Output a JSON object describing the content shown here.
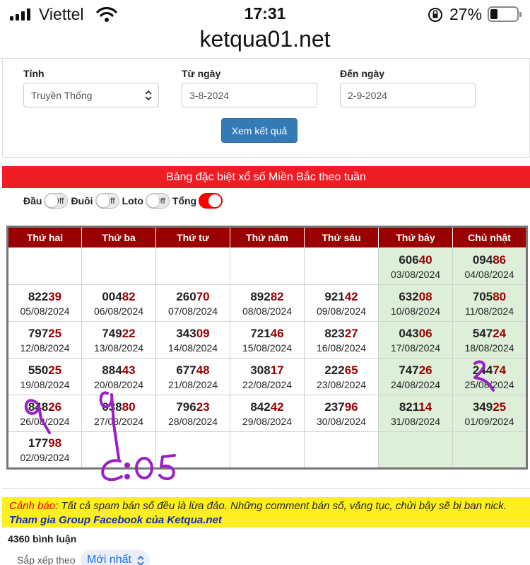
{
  "status_bar": {
    "carrier": "Viettel",
    "time": "17:31",
    "battery_percent": "27%",
    "battery_level": 0.27
  },
  "browser": {
    "url": "ketqua01.net"
  },
  "filter": {
    "province_label": "Tỉnh",
    "province_value": "Truyền Thống",
    "from_label": "Từ ngày",
    "from_value": "3-8-2024",
    "to_label": "Đến ngày",
    "to_value": "2-9-2024",
    "submit_label": "Xem kết quả"
  },
  "banner_title": "Bảng đặc biệt xổ số Miền Bắc theo tuần",
  "toggles": [
    {
      "label": "Đầu",
      "state": "Off"
    },
    {
      "label": "Đuôi",
      "state": "Off"
    },
    {
      "label": "Loto",
      "state": "Off"
    },
    {
      "label": "Tổng",
      "state": ""
    }
  ],
  "table": {
    "headers": [
      "Thứ hai",
      "Thứ ba",
      "Thứ tư",
      "Thứ năm",
      "Thứ sáu",
      "Thứ bảy",
      "Chủ nhật"
    ],
    "rows": [
      [
        {
          "num": "",
          "tail": "",
          "date": ""
        },
        {
          "num": "",
          "tail": "",
          "date": ""
        },
        {
          "num": "",
          "tail": "",
          "date": ""
        },
        {
          "num": "",
          "tail": "",
          "date": ""
        },
        {
          "num": "",
          "tail": "",
          "date": ""
        },
        {
          "num": "606",
          "tail": "40",
          "date": "03/08/2024"
        },
        {
          "num": "094",
          "tail": "86",
          "date": "04/08/2024"
        }
      ],
      [
        {
          "num": "822",
          "tail": "39",
          "date": "05/08/2024"
        },
        {
          "num": "004",
          "tail": "82",
          "date": "06/08/2024"
        },
        {
          "num": "260",
          "tail": "70",
          "date": "07/08/2024"
        },
        {
          "num": "892",
          "tail": "82",
          "date": "08/08/2024"
        },
        {
          "num": "921",
          "tail": "42",
          "date": "09/08/2024"
        },
        {
          "num": "632",
          "tail": "08",
          "date": "10/08/2024"
        },
        {
          "num": "705",
          "tail": "80",
          "date": "11/08/2024"
        }
      ],
      [
        {
          "num": "797",
          "tail": "25",
          "date": "12/08/2024"
        },
        {
          "num": "749",
          "tail": "22",
          "date": "13/08/2024"
        },
        {
          "num": "343",
          "tail": "09",
          "date": "14/08/2024"
        },
        {
          "num": "721",
          "tail": "46",
          "date": "15/08/2024"
        },
        {
          "num": "823",
          "tail": "27",
          "date": "16/08/2024"
        },
        {
          "num": "043",
          "tail": "06",
          "date": "17/08/2024"
        },
        {
          "num": "547",
          "tail": "24",
          "date": "18/08/2024"
        }
      ],
      [
        {
          "num": "550",
          "tail": "25",
          "date": "19/08/2024"
        },
        {
          "num": "884",
          "tail": "43",
          "date": "20/08/2024"
        },
        {
          "num": "677",
          "tail": "48",
          "date": "21/08/2024"
        },
        {
          "num": "308",
          "tail": "17",
          "date": "22/08/2024"
        },
        {
          "num": "222",
          "tail": "65",
          "date": "23/08/2024"
        },
        {
          "num": "747",
          "tail": "26",
          "date": "24/08/2024"
        },
        {
          "num": "244",
          "tail": "74",
          "date": "25/08/2024"
        }
      ],
      [
        {
          "num": "848",
          "tail": "26",
          "date": "26/08/2024"
        },
        {
          "num": "038",
          "tail": "80",
          "date": "27/08/2024"
        },
        {
          "num": "796",
          "tail": "23",
          "date": "28/08/2024"
        },
        {
          "num": "842",
          "tail": "42",
          "date": "29/08/2024"
        },
        {
          "num": "237",
          "tail": "96",
          "date": "30/08/2024"
        },
        {
          "num": "821",
          "tail": "14",
          "date": "31/08/2024"
        },
        {
          "num": "349",
          "tail": "25",
          "date": "01/09/2024"
        }
      ],
      [
        {
          "num": "177",
          "tail": "98",
          "date": "02/09/2024"
        },
        {
          "num": "",
          "tail": "",
          "date": ""
        },
        {
          "num": "",
          "tail": "",
          "date": ""
        },
        {
          "num": "",
          "tail": "",
          "date": ""
        },
        {
          "num": "",
          "tail": "",
          "date": ""
        },
        {
          "num": "",
          "tail": "",
          "date": ""
        },
        {
          "num": "",
          "tail": "",
          "date": ""
        }
      ]
    ]
  },
  "warning": {
    "lead": "Cảnh báo",
    "text": ": Tất cả spam bán số đều là lừa đảo. Những comment bán số, văng tục, chửi bậy sẽ bị ban nick.",
    "facebook_link": "Tham gia Group Facebook của Ketqua.net"
  },
  "comments": {
    "count_label": "4360 bình luận",
    "sort_label": "Sắp xếp theo",
    "sort_value": "Mới nhất"
  },
  "colors": {
    "header_red": "#990000",
    "banner_red": "#ee1c25",
    "weekend_green": "#ddefd8",
    "button_blue": "#337ab7",
    "warning_yellow": "#ffee22",
    "handwriting_purple": "#9b1fc7"
  }
}
